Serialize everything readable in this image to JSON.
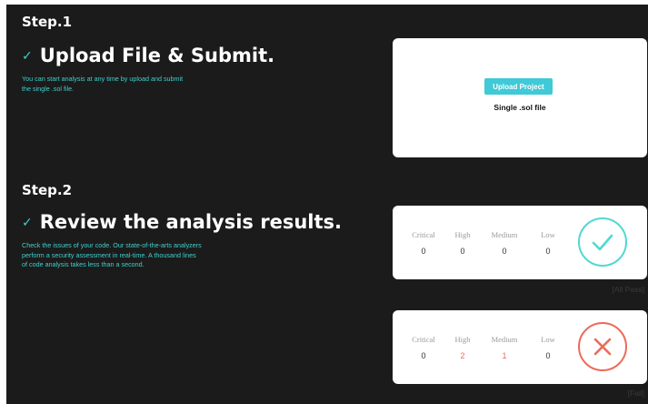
{
  "step1": {
    "heading": "Step.1",
    "title": "Upload File & Submit.",
    "desc_lines": [
      "You can start analysis at any time by upload and submit",
      "the single .sol file."
    ],
    "upload_button": "Upload Project",
    "file_hint": "Single .sol file"
  },
  "step2": {
    "heading": "Step.2",
    "title": "Review the analysis results.",
    "desc_lines": [
      "Check the issues of your code. Our state-of-the-arts analyzers",
      "perform a security assessment in real-time. A thousand lines",
      "of code analysis takes less than a second."
    ]
  },
  "results": [
    {
      "status": "pass",
      "caption": "[All Pass]",
      "severities": [
        {
          "name": "Critical",
          "count": "0"
        },
        {
          "name": "High",
          "count": "0"
        },
        {
          "name": "Medium",
          "count": "0"
        },
        {
          "name": "Low",
          "count": "0"
        }
      ]
    },
    {
      "status": "fail",
      "caption": "[Fail]",
      "severities": [
        {
          "name": "Critical",
          "count": "0"
        },
        {
          "name": "High",
          "count": "2"
        },
        {
          "name": "Medium",
          "count": "1"
        },
        {
          "name": "Low",
          "count": "0"
        }
      ]
    }
  ],
  "colors": {
    "background": "#1b1b1b",
    "accent": "#3ed3cf",
    "button": "#40c9d6",
    "pass": "#4fd9d2",
    "fail": "#ee6a5a"
  },
  "icons": {
    "step_check": "checkmark-icon",
    "pass": "check-circle-icon",
    "fail": "x-circle-icon"
  }
}
